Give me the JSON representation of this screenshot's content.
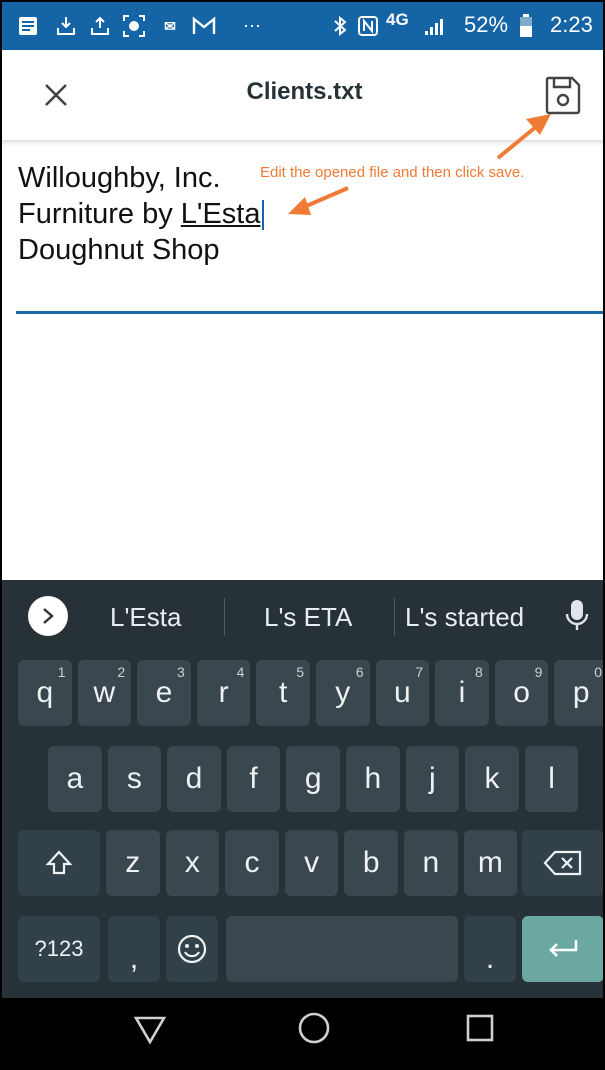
{
  "status_bar": {
    "battery_percent": "52%",
    "time": "2:23",
    "network": "4G"
  },
  "app_bar": {
    "title": "Clients.txt",
    "close_icon": "close-icon",
    "save_icon": "floppy-save-icon"
  },
  "editor": {
    "lines": [
      "Willoughby, Inc.",
      "Furniture by ",
      "L'Esta",
      "Doughnut Shop"
    ]
  },
  "annotation": {
    "text": "Edit the opened file and then click save.",
    "color": "#f07b36"
  },
  "keyboard": {
    "suggestions": [
      "L'Esta",
      "L's ETA",
      "L's started"
    ],
    "row1": [
      {
        "k": "q",
        "h": "1"
      },
      {
        "k": "w",
        "h": "2"
      },
      {
        "k": "e",
        "h": "3"
      },
      {
        "k": "r",
        "h": "4"
      },
      {
        "k": "t",
        "h": "5"
      },
      {
        "k": "y",
        "h": "6"
      },
      {
        "k": "u",
        "h": "7"
      },
      {
        "k": "i",
        "h": "8"
      },
      {
        "k": "o",
        "h": "9"
      },
      {
        "k": "p",
        "h": "0"
      }
    ],
    "row2": [
      "a",
      "s",
      "d",
      "f",
      "g",
      "h",
      "j",
      "k",
      "l"
    ],
    "row3": [
      "z",
      "x",
      "c",
      "v",
      "b",
      "n",
      "m"
    ],
    "symbols_label": "?123",
    "comma_label": ",",
    "period_label": "."
  },
  "colors": {
    "status_bar": "#1565a6",
    "keyboard_bg": "#263238",
    "key_bg": "#3a474e",
    "enter_key": "#6aa8a1",
    "accent": "#1b6aa6"
  }
}
